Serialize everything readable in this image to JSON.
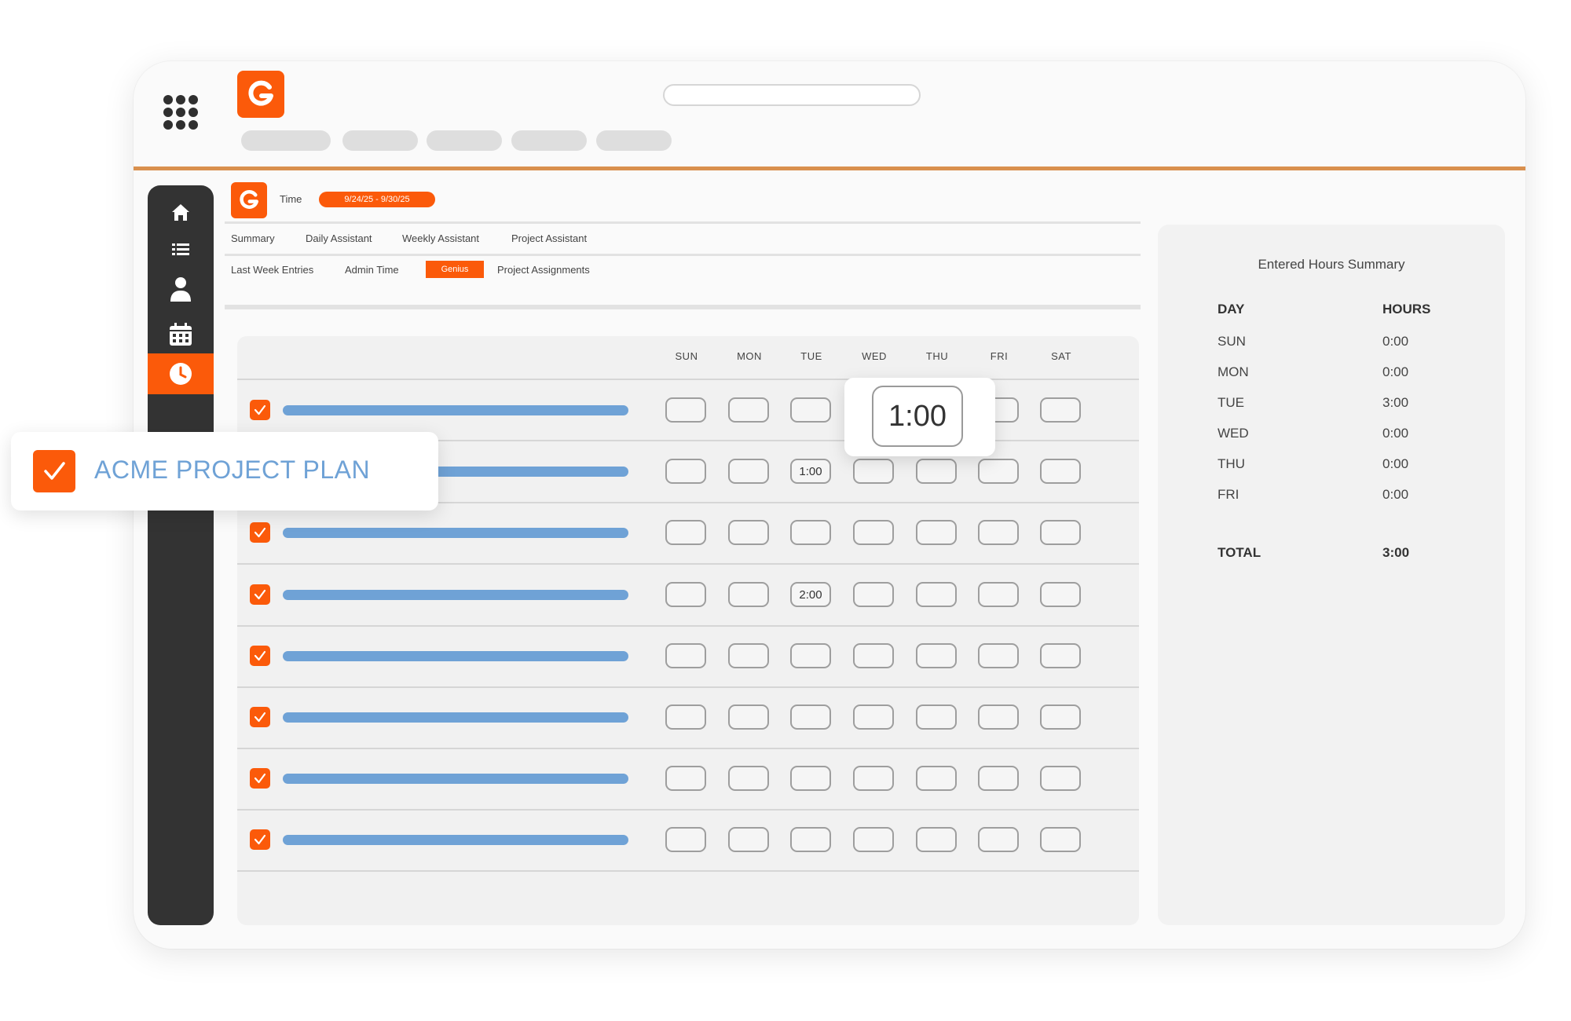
{
  "colors": {
    "accent": "#fb5a0a",
    "accent_line": "#d9904e",
    "task_bar": "#6fa2d6",
    "sidebar": "#333333"
  },
  "header": {
    "logo_icon": "g-logo-icon",
    "apps_icon": "apps-grid-icon"
  },
  "sidebar": {
    "items": [
      "home-icon",
      "list-icon",
      "user-icon",
      "calendar-icon",
      "clock-icon"
    ],
    "active": "clock-icon"
  },
  "page": {
    "title": "Time",
    "date_range": "9/24/25 - 9/30/25",
    "tabs_row1": [
      "Summary",
      "Daily Assistant",
      "Weekly Assistant",
      "Project Assistant"
    ],
    "tabs_row2": [
      "Last Week Entries",
      "Admin Time",
      "Genius",
      "Project Assignments"
    ],
    "active_tab": "Genius"
  },
  "grid": {
    "days": [
      "SUN",
      "MON",
      "TUE",
      "WED",
      "THU",
      "FRI",
      "SAT"
    ],
    "rows": [
      {
        "checked": true,
        "cells": [
          "",
          "",
          "",
          "",
          "",
          "",
          ""
        ]
      },
      {
        "checked": true,
        "cells": [
          "",
          "",
          "1:00",
          "",
          "",
          "",
          ""
        ]
      },
      {
        "checked": true,
        "cells": [
          "",
          "",
          "",
          "",
          "",
          "",
          ""
        ]
      },
      {
        "checked": true,
        "cells": [
          "",
          "",
          "2:00",
          "",
          "",
          "",
          ""
        ]
      },
      {
        "checked": true,
        "cells": [
          "",
          "",
          "",
          "",
          "",
          "",
          ""
        ]
      },
      {
        "checked": true,
        "cells": [
          "",
          "",
          "",
          "",
          "",
          "",
          ""
        ]
      },
      {
        "checked": true,
        "cells": [
          "",
          "",
          "",
          "",
          "",
          "",
          ""
        ]
      },
      {
        "checked": true,
        "cells": [
          "",
          "",
          "",
          "",
          "",
          "",
          ""
        ]
      }
    ]
  },
  "popover": {
    "value": "1:00"
  },
  "project_card": {
    "name": "ACME PROJECT PLAN",
    "checked": true
  },
  "summary": {
    "title": "Entered Hours Summary",
    "col_day": "DAY",
    "col_hours": "HOURS",
    "rows": [
      {
        "day": "SUN",
        "hours": "0:00"
      },
      {
        "day": "MON",
        "hours": "0:00"
      },
      {
        "day": "TUE",
        "hours": "3:00"
      },
      {
        "day": "WED",
        "hours": "0:00"
      },
      {
        "day": "THU",
        "hours": "0:00"
      },
      {
        "day": "FRI",
        "hours": "0:00"
      }
    ],
    "total_label": "TOTAL",
    "total_value": "3:00"
  }
}
